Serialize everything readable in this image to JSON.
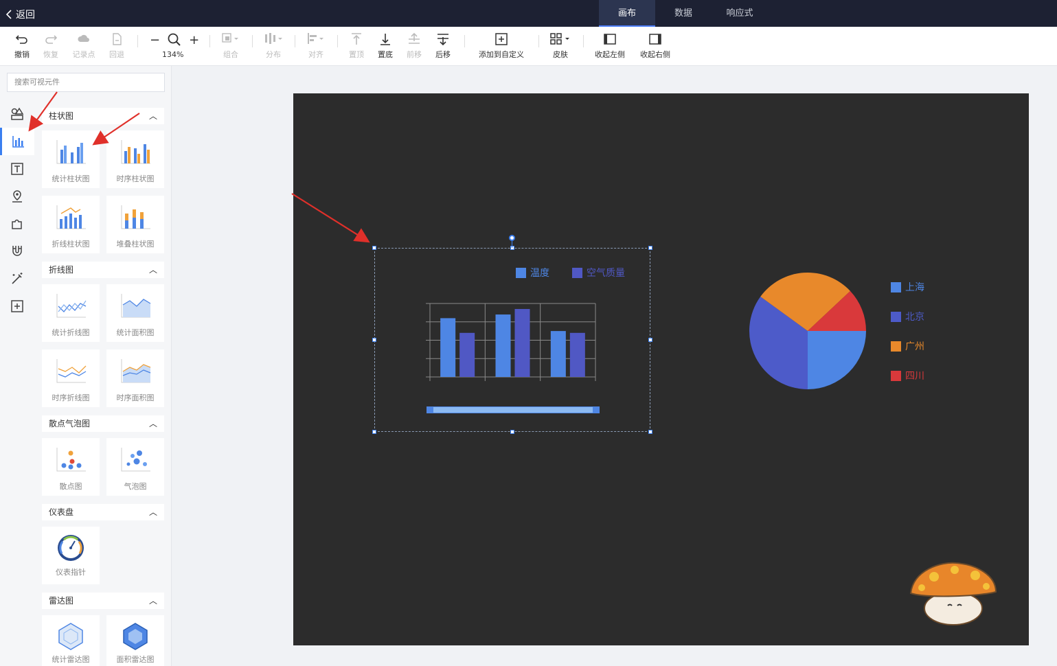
{
  "topbar": {
    "back_label": "返回",
    "tabs": [
      {
        "label": "画布",
        "active": true
      },
      {
        "label": "数据",
        "active": false
      },
      {
        "label": "响应式",
        "active": false
      }
    ]
  },
  "toolbar": {
    "undo": "撤销",
    "redo": "恢复",
    "record": "记录点",
    "rollback": "回退",
    "zoom_level": "134%",
    "group": "组合",
    "distribute": "分布",
    "align": "对齐",
    "to_top": "置顶",
    "to_bottom": "置底",
    "forward": "前移",
    "backward": "后移",
    "add_custom": "添加到自定义",
    "skin": "皮肤",
    "collapse_left": "收起左侧",
    "collapse_right": "收起右侧"
  },
  "sidebar": {
    "search_placeholder": "搜索可视元件",
    "sections": [
      {
        "title": "柱状图",
        "items": [
          "统计柱状图",
          "时序柱状图",
          "折线柱状图",
          "堆叠柱状图"
        ]
      },
      {
        "title": "折线图",
        "items": [
          "统计折线图",
          "统计面积图",
          "时序折线图",
          "时序面积图"
        ]
      },
      {
        "title": "散点气泡图",
        "items": [
          "散点图",
          "气泡图"
        ]
      },
      {
        "title": "仪表盘",
        "items": [
          "仪表指针"
        ]
      },
      {
        "title": "雷达图",
        "items": [
          "统计雷达图",
          "面积雷达图"
        ]
      }
    ]
  },
  "canvas": {
    "bg_color": "#2c2c2c"
  },
  "chart_data": [
    {
      "type": "bar",
      "categories": [
        "",
        "",
        ""
      ],
      "series": [
        {
          "name": "温度",
          "values": [
            3.2,
            3.4,
            2.5
          ],
          "color": "#4e86e4"
        },
        {
          "name": "空气质量",
          "values": [
            2.4,
            3.7,
            2.4
          ],
          "color": "#5058c4"
        }
      ],
      "ylim": [
        0,
        4
      ],
      "grid": true,
      "legend": "top-right"
    },
    {
      "type": "pie",
      "series": [
        {
          "name": "上海",
          "value": 25,
          "color": "#4e86e4"
        },
        {
          "name": "北京",
          "value": 35,
          "color": "#4d5bc9"
        },
        {
          "name": "广州",
          "value": 28,
          "color": "#e8892b"
        },
        {
          "name": "四川",
          "value": 12,
          "color": "#d9393b"
        }
      ],
      "legend": "right"
    }
  ]
}
